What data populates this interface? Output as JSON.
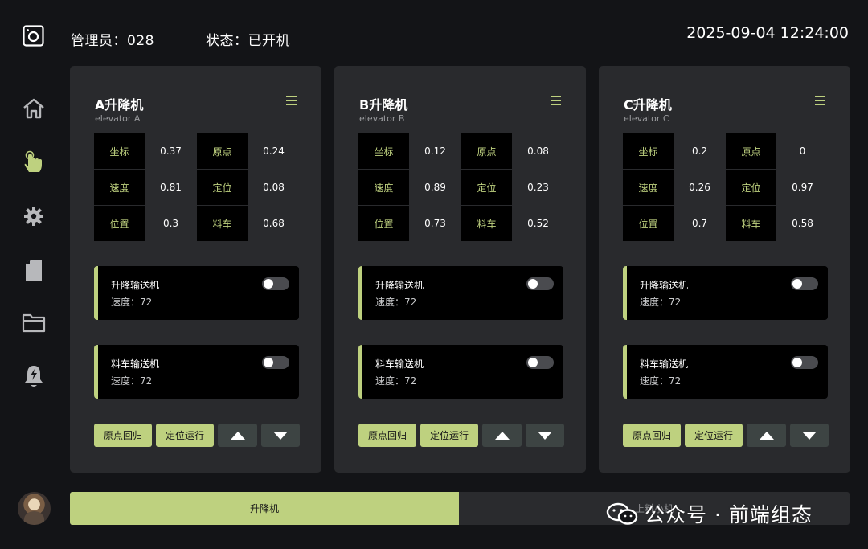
{
  "header": {
    "admin": "管理员：028",
    "status": "状态：已开机",
    "datetime": "2025-09-04 12:24:00"
  },
  "sidebar": {
    "items": [
      {
        "icon": "home-icon",
        "active": false
      },
      {
        "icon": "hand-pointer-icon",
        "active": true
      },
      {
        "icon": "gear-icon",
        "active": false
      },
      {
        "icon": "document-icon",
        "active": false
      },
      {
        "icon": "folder-icon",
        "active": false
      },
      {
        "icon": "alarm-bell-icon",
        "active": false
      }
    ]
  },
  "labels": {
    "coord": "坐标",
    "origin": "原点",
    "speed": "速度",
    "position_set": "定位",
    "position": "位置",
    "cart": "料车",
    "lift_conveyor": "升降输送机",
    "cart_conveyor": "料车输送机",
    "btn_home": "原点回归",
    "btn_run": "定位运行"
  },
  "panels": [
    {
      "title": "A升降机",
      "subtitle": "elevator A",
      "coord": "0.37",
      "origin": "0.24",
      "speed": "0.81",
      "position_set": "0.08",
      "position": "0.3",
      "cart": "0.68",
      "lift_conveyor_speed": "速度：72",
      "cart_conveyor_speed": "速度：72"
    },
    {
      "title": "B升降机",
      "subtitle": "elevator B",
      "coord": "0.12",
      "origin": "0.08",
      "speed": "0.89",
      "position_set": "0.23",
      "position": "0.73",
      "cart": "0.52",
      "lift_conveyor_speed": "速度：72",
      "cart_conveyor_speed": "速度：72"
    },
    {
      "title": "C升降机",
      "subtitle": "elevator C",
      "coord": "0.2",
      "origin": "0",
      "speed": "0.26",
      "position_set": "0.97",
      "position": "0.7",
      "cart": "0.58",
      "lift_conveyor_speed": "速度：72",
      "cart_conveyor_speed": "速度：72"
    }
  ],
  "tabs": {
    "active": "升降机",
    "inactive": "上料小机"
  },
  "watermark": "公众号 · 前端组态",
  "colors": {
    "accent": "#bed17f",
    "panel": "#292a2d",
    "background": "#131417",
    "button_dark": "#3d4443"
  }
}
